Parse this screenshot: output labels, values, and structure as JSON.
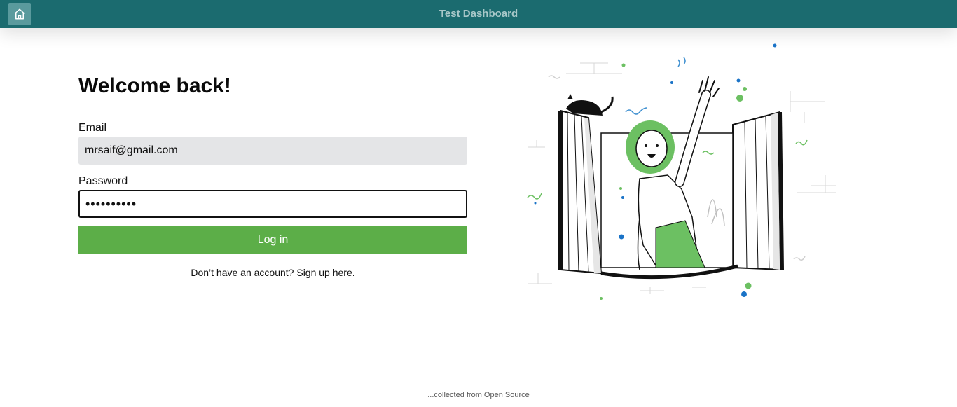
{
  "header": {
    "title": "Test Dashboard",
    "home_icon": "home-icon",
    "bar_color": "#1b6b6f"
  },
  "login": {
    "heading": "Welcome back!",
    "email_label": "Email",
    "email_value": "mrsaif@gmail.com",
    "password_label": "Password",
    "password_value": "••••••••••",
    "submit_label": "Log in",
    "submit_color": "#5cae48",
    "signup_text": "Don’t have an account? Sign up here."
  },
  "illustration": {
    "name": "woman-waving-from-window",
    "accent_color": "#6cc062"
  },
  "footer": {
    "text": "...collected from Open Source"
  }
}
